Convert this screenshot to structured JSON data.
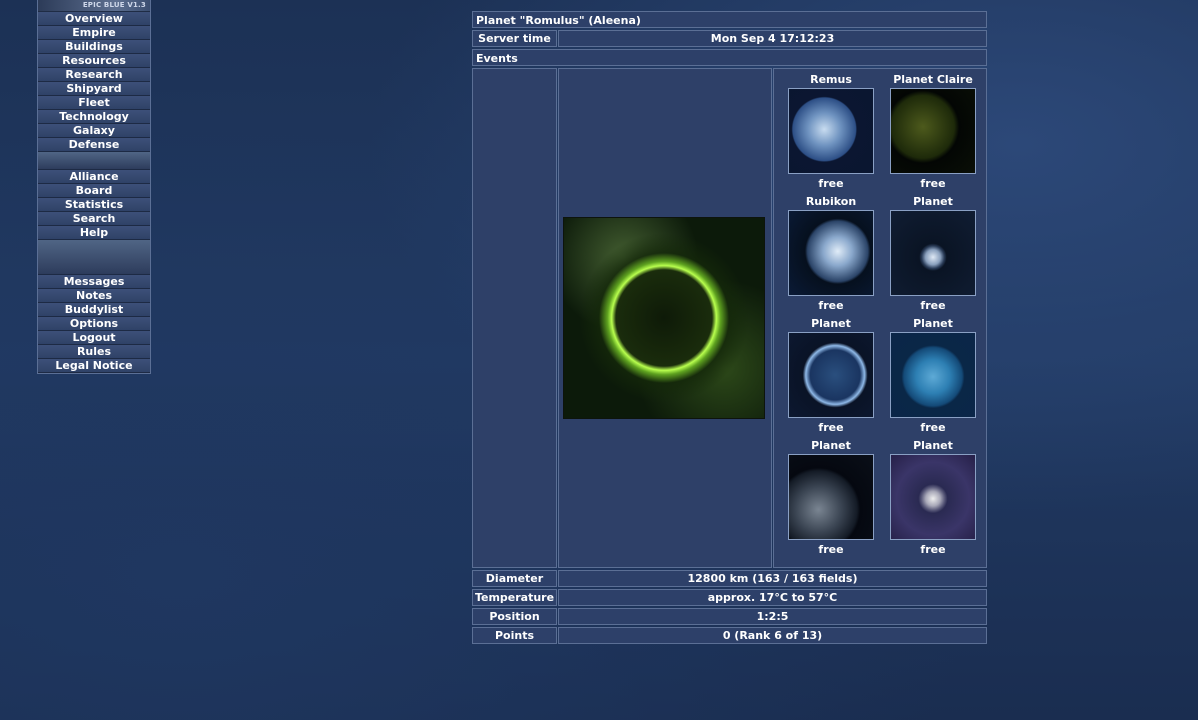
{
  "menu": {
    "logo_text": "EPIC BLUE V1.3",
    "group1": [
      "Overview",
      "Empire",
      "Buildings",
      "Resources",
      "Research",
      "Shipyard",
      "Fleet",
      "Technology",
      "Galaxy",
      "Defense"
    ],
    "group2": [
      "Alliance",
      "Board",
      "Statistics",
      "Search",
      "Help"
    ],
    "group3": [
      "Messages",
      "Notes",
      "Buddylist",
      "Options",
      "Logout",
      "Rules",
      "Legal Notice"
    ]
  },
  "header": {
    "title": "Planet \"Romulus\" (Aleena)"
  },
  "server_time": {
    "label": "Server time",
    "value": "Mon Sep 4 17:12:23"
  },
  "events": {
    "label": "Events"
  },
  "planets": [
    {
      "name": "Remus",
      "status": "free",
      "icon": "planet-remus-icon"
    },
    {
      "name": "Planet Claire",
      "status": "free",
      "icon": "planet-claire-icon"
    },
    {
      "name": "Rubikon",
      "status": "free",
      "icon": "planet-rubikon-icon"
    },
    {
      "name": "Planet",
      "status": "free",
      "icon": "planet-icon"
    },
    {
      "name": "Planet",
      "status": "free",
      "icon": "planet-icon"
    },
    {
      "name": "Planet",
      "status": "free",
      "icon": "planet-icon"
    },
    {
      "name": "Planet",
      "status": "free",
      "icon": "planet-icon"
    },
    {
      "name": "Planet",
      "status": "free",
      "icon": "planet-icon"
    }
  ],
  "info": {
    "diameter": {
      "label": "Diameter",
      "value": "12800 km (163 / 163 fields)"
    },
    "temperature": {
      "label": "Temperature",
      "value": "approx. 17°C to 57°C"
    },
    "position": {
      "label": "Position",
      "value": "1:2:5"
    },
    "points": {
      "label": "Points",
      "value": "0 (Rank 6 of 13)"
    }
  }
}
